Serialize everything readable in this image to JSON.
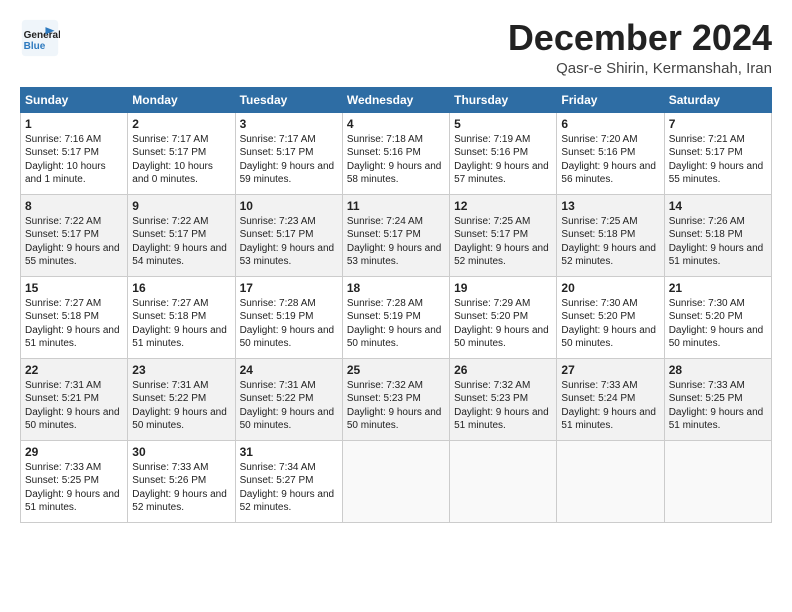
{
  "header": {
    "logo_general": "General",
    "logo_blue": "Blue",
    "month_title": "December 2024",
    "location": "Qasr-e Shirin, Kermanshah, Iran"
  },
  "weekdays": [
    "Sunday",
    "Monday",
    "Tuesday",
    "Wednesday",
    "Thursday",
    "Friday",
    "Saturday"
  ],
  "weeks": [
    [
      {
        "day": "1",
        "sunrise": "Sunrise: 7:16 AM",
        "sunset": "Sunset: 5:17 PM",
        "daylight": "Daylight: 10 hours and 1 minute."
      },
      {
        "day": "2",
        "sunrise": "Sunrise: 7:17 AM",
        "sunset": "Sunset: 5:17 PM",
        "daylight": "Daylight: 10 hours and 0 minutes."
      },
      {
        "day": "3",
        "sunrise": "Sunrise: 7:17 AM",
        "sunset": "Sunset: 5:17 PM",
        "daylight": "Daylight: 9 hours and 59 minutes."
      },
      {
        "day": "4",
        "sunrise": "Sunrise: 7:18 AM",
        "sunset": "Sunset: 5:16 PM",
        "daylight": "Daylight: 9 hours and 58 minutes."
      },
      {
        "day": "5",
        "sunrise": "Sunrise: 7:19 AM",
        "sunset": "Sunset: 5:16 PM",
        "daylight": "Daylight: 9 hours and 57 minutes."
      },
      {
        "day": "6",
        "sunrise": "Sunrise: 7:20 AM",
        "sunset": "Sunset: 5:16 PM",
        "daylight": "Daylight: 9 hours and 56 minutes."
      },
      {
        "day": "7",
        "sunrise": "Sunrise: 7:21 AM",
        "sunset": "Sunset: 5:17 PM",
        "daylight": "Daylight: 9 hours and 55 minutes."
      }
    ],
    [
      {
        "day": "8",
        "sunrise": "Sunrise: 7:22 AM",
        "sunset": "Sunset: 5:17 PM",
        "daylight": "Daylight: 9 hours and 55 minutes."
      },
      {
        "day": "9",
        "sunrise": "Sunrise: 7:22 AM",
        "sunset": "Sunset: 5:17 PM",
        "daylight": "Daylight: 9 hours and 54 minutes."
      },
      {
        "day": "10",
        "sunrise": "Sunrise: 7:23 AM",
        "sunset": "Sunset: 5:17 PM",
        "daylight": "Daylight: 9 hours and 53 minutes."
      },
      {
        "day": "11",
        "sunrise": "Sunrise: 7:24 AM",
        "sunset": "Sunset: 5:17 PM",
        "daylight": "Daylight: 9 hours and 53 minutes."
      },
      {
        "day": "12",
        "sunrise": "Sunrise: 7:25 AM",
        "sunset": "Sunset: 5:17 PM",
        "daylight": "Daylight: 9 hours and 52 minutes."
      },
      {
        "day": "13",
        "sunrise": "Sunrise: 7:25 AM",
        "sunset": "Sunset: 5:18 PM",
        "daylight": "Daylight: 9 hours and 52 minutes."
      },
      {
        "day": "14",
        "sunrise": "Sunrise: 7:26 AM",
        "sunset": "Sunset: 5:18 PM",
        "daylight": "Daylight: 9 hours and 51 minutes."
      }
    ],
    [
      {
        "day": "15",
        "sunrise": "Sunrise: 7:27 AM",
        "sunset": "Sunset: 5:18 PM",
        "daylight": "Daylight: 9 hours and 51 minutes."
      },
      {
        "day": "16",
        "sunrise": "Sunrise: 7:27 AM",
        "sunset": "Sunset: 5:18 PM",
        "daylight": "Daylight: 9 hours and 51 minutes."
      },
      {
        "day": "17",
        "sunrise": "Sunrise: 7:28 AM",
        "sunset": "Sunset: 5:19 PM",
        "daylight": "Daylight: 9 hours and 50 minutes."
      },
      {
        "day": "18",
        "sunrise": "Sunrise: 7:28 AM",
        "sunset": "Sunset: 5:19 PM",
        "daylight": "Daylight: 9 hours and 50 minutes."
      },
      {
        "day": "19",
        "sunrise": "Sunrise: 7:29 AM",
        "sunset": "Sunset: 5:20 PM",
        "daylight": "Daylight: 9 hours and 50 minutes."
      },
      {
        "day": "20",
        "sunrise": "Sunrise: 7:30 AM",
        "sunset": "Sunset: 5:20 PM",
        "daylight": "Daylight: 9 hours and 50 minutes."
      },
      {
        "day": "21",
        "sunrise": "Sunrise: 7:30 AM",
        "sunset": "Sunset: 5:20 PM",
        "daylight": "Daylight: 9 hours and 50 minutes."
      }
    ],
    [
      {
        "day": "22",
        "sunrise": "Sunrise: 7:31 AM",
        "sunset": "Sunset: 5:21 PM",
        "daylight": "Daylight: 9 hours and 50 minutes."
      },
      {
        "day": "23",
        "sunrise": "Sunrise: 7:31 AM",
        "sunset": "Sunset: 5:22 PM",
        "daylight": "Daylight: 9 hours and 50 minutes."
      },
      {
        "day": "24",
        "sunrise": "Sunrise: 7:31 AM",
        "sunset": "Sunset: 5:22 PM",
        "daylight": "Daylight: 9 hours and 50 minutes."
      },
      {
        "day": "25",
        "sunrise": "Sunrise: 7:32 AM",
        "sunset": "Sunset: 5:23 PM",
        "daylight": "Daylight: 9 hours and 50 minutes."
      },
      {
        "day": "26",
        "sunrise": "Sunrise: 7:32 AM",
        "sunset": "Sunset: 5:23 PM",
        "daylight": "Daylight: 9 hours and 51 minutes."
      },
      {
        "day": "27",
        "sunrise": "Sunrise: 7:33 AM",
        "sunset": "Sunset: 5:24 PM",
        "daylight": "Daylight: 9 hours and 51 minutes."
      },
      {
        "day": "28",
        "sunrise": "Sunrise: 7:33 AM",
        "sunset": "Sunset: 5:25 PM",
        "daylight": "Daylight: 9 hours and 51 minutes."
      }
    ],
    [
      {
        "day": "29",
        "sunrise": "Sunrise: 7:33 AM",
        "sunset": "Sunset: 5:25 PM",
        "daylight": "Daylight: 9 hours and 51 minutes."
      },
      {
        "day": "30",
        "sunrise": "Sunrise: 7:33 AM",
        "sunset": "Sunset: 5:26 PM",
        "daylight": "Daylight: 9 hours and 52 minutes."
      },
      {
        "day": "31",
        "sunrise": "Sunrise: 7:34 AM",
        "sunset": "Sunset: 5:27 PM",
        "daylight": "Daylight: 9 hours and 52 minutes."
      },
      null,
      null,
      null,
      null
    ]
  ]
}
